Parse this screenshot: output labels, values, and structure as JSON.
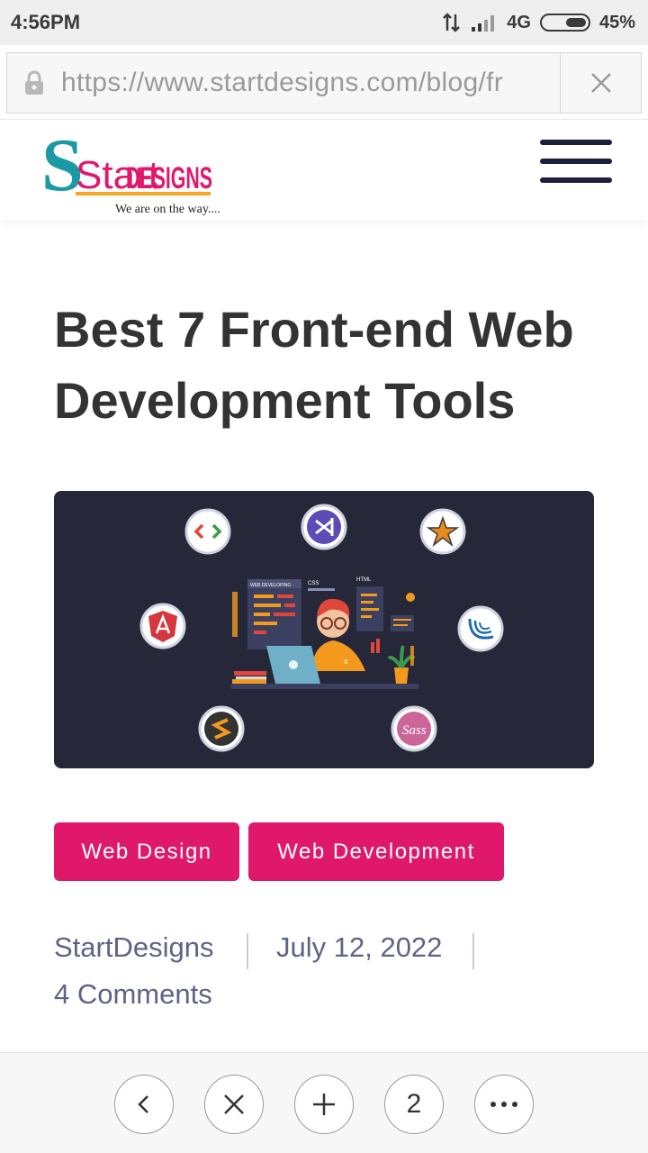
{
  "status_bar": {
    "time": "4:56PM",
    "network": "4G",
    "battery": "45%",
    "battery_level": 0.45
  },
  "browser": {
    "url": "https://www.startdesigns.com/blog/fr",
    "lock_icon": "lock-icon",
    "close_icon": "close-icon"
  },
  "header": {
    "logo_word_start": "Start",
    "logo_word_designs": "DESIGNS",
    "logo_tagline": "We are on the way......",
    "menu_icon": "hamburger-icon"
  },
  "post": {
    "title_line1": "Best 7 Front-end Web",
    "title_line2": "Development Tools",
    "hero_labels": {
      "panel1": "WEB DEVELOPING",
      "panel2": "CSS",
      "panel3": "HTML"
    },
    "tags": [
      "Web Design",
      "Web Development"
    ],
    "author": "StartDesigns",
    "date": "July 12, 2022",
    "comments": "4 Comments"
  },
  "bottom_nav": {
    "tab_count": "2"
  },
  "colors": {
    "accent": "#e0186c",
    "hero_bg": "#262839",
    "title": "#333333",
    "meta": "#5d6485"
  }
}
